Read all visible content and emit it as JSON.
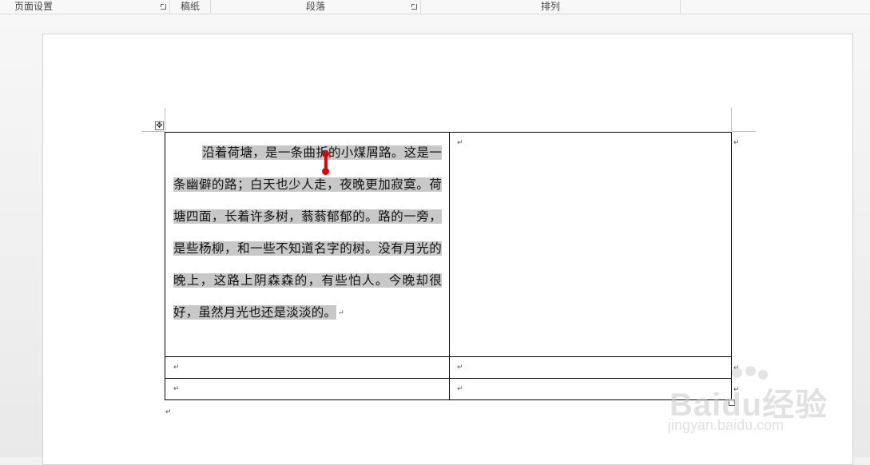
{
  "ribbon": {
    "groups": [
      {
        "label": "页面设置",
        "has_launcher": true
      },
      {
        "label": "稿纸",
        "has_launcher": false
      },
      {
        "label": "段落",
        "has_launcher": true
      },
      {
        "label": "排列",
        "has_launcher": false
      }
    ]
  },
  "document": {
    "table": {
      "cell_1_1": {
        "text": "沿着荷塘，是一条曲折的小煤屑路。这是一条幽僻的路；白天也少人走，夜晚更加寂寞。荷塘四面，长着许多树，蓊蓊郁郁的。路的一旁，是些杨柳，和一些不知道名字的树。没有月光的晚上，这路上阴森森的，有些怕人。今晚却很好，虽然月光也还是淡淡的。",
        "selected": true
      },
      "paragraph_mark": "↵",
      "rows": 3,
      "columns": 2
    },
    "move_handle_icon": "table-move-handle-icon"
  },
  "watermark": {
    "brand": "Baidu经验",
    "url": "jingyan.baidu.com"
  },
  "colors": {
    "selection": "#c8c8c8",
    "cursor": "#e00000"
  }
}
